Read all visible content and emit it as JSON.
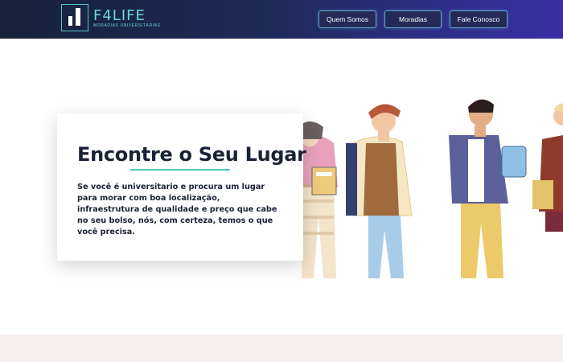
{
  "header": {
    "brand": "F4LIFE",
    "tagline": "MORADIAS UNIVERSITÁRIAS",
    "nav": [
      {
        "label": "Quem Somos"
      },
      {
        "label": "Moradias"
      },
      {
        "label": "Fale Conosco"
      }
    ]
  },
  "hero": {
    "title": "Encontre o Seu Lugar",
    "description": "Se você é universitario e procura um lugar para morar com boa localização, infraestrutura de qualidade e preço que cabe no seu bolso, nós, com certeza, temos o que você precisa."
  },
  "colors": {
    "accent": "#4cc7bf",
    "nav_from": "#16213a",
    "nav_to": "#3b2fa6"
  }
}
